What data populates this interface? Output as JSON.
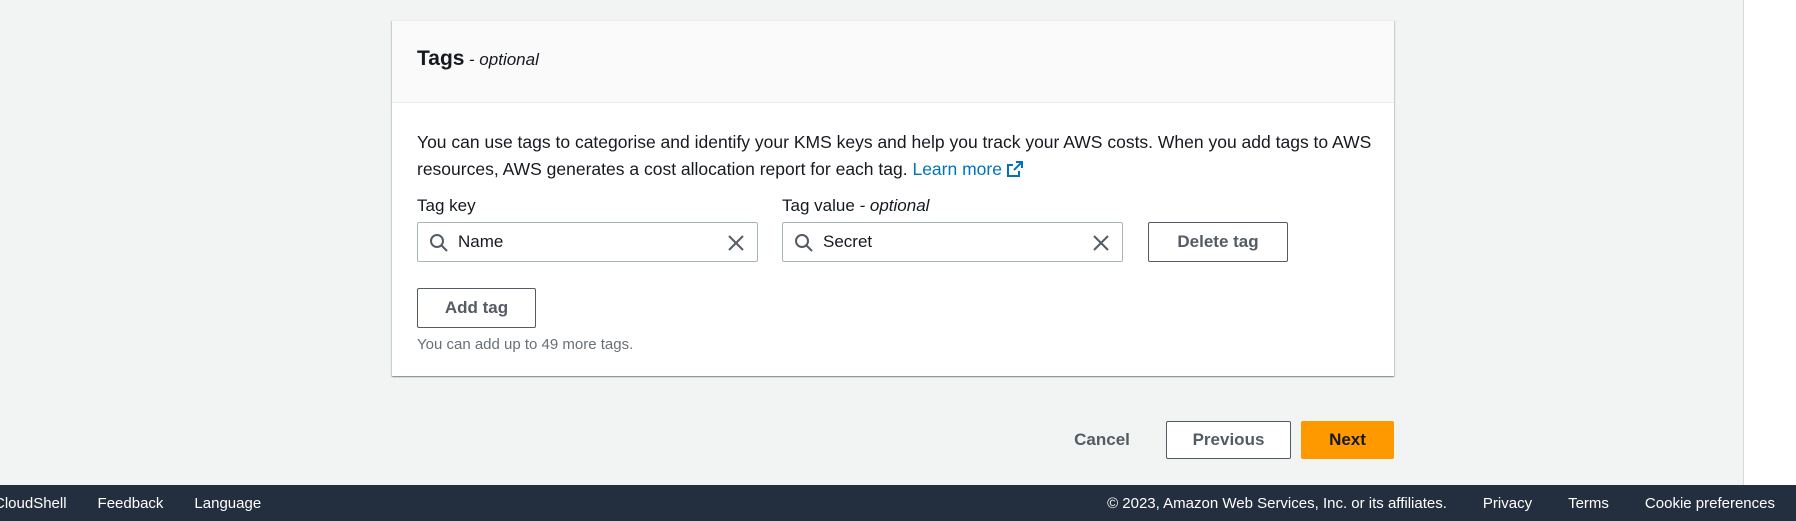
{
  "tags_panel": {
    "title": "Tags",
    "title_suffix": "- optional",
    "description": "You can use tags to categorise and identify your KMS keys and help you track your AWS costs. When you add tags to AWS resources, AWS generates a cost allocation report for each tag.",
    "learn_more": "Learn more",
    "tag_key_label": "Tag key",
    "tag_value_label": "Tag value",
    "tag_value_suffix": "- optional",
    "tag_key_value": "Name",
    "tag_value_value": "Secret",
    "delete_tag": "Delete tag",
    "add_tag": "Add tag",
    "hint": "You can add up to 49 more tags."
  },
  "actions": {
    "cancel": "Cancel",
    "previous": "Previous",
    "next": "Next"
  },
  "footer": {
    "left_links": [
      "CloudShell",
      "Feedback",
      "Language"
    ],
    "copyright": "© 2023, Amazon Web Services, Inc. or its affiliates.",
    "right_links": [
      "Privacy",
      "Terms",
      "Cookie preferences"
    ]
  },
  "colors": {
    "primary": "#ff9900",
    "link": "#0073bb",
    "footer_bg": "#232f3e"
  }
}
